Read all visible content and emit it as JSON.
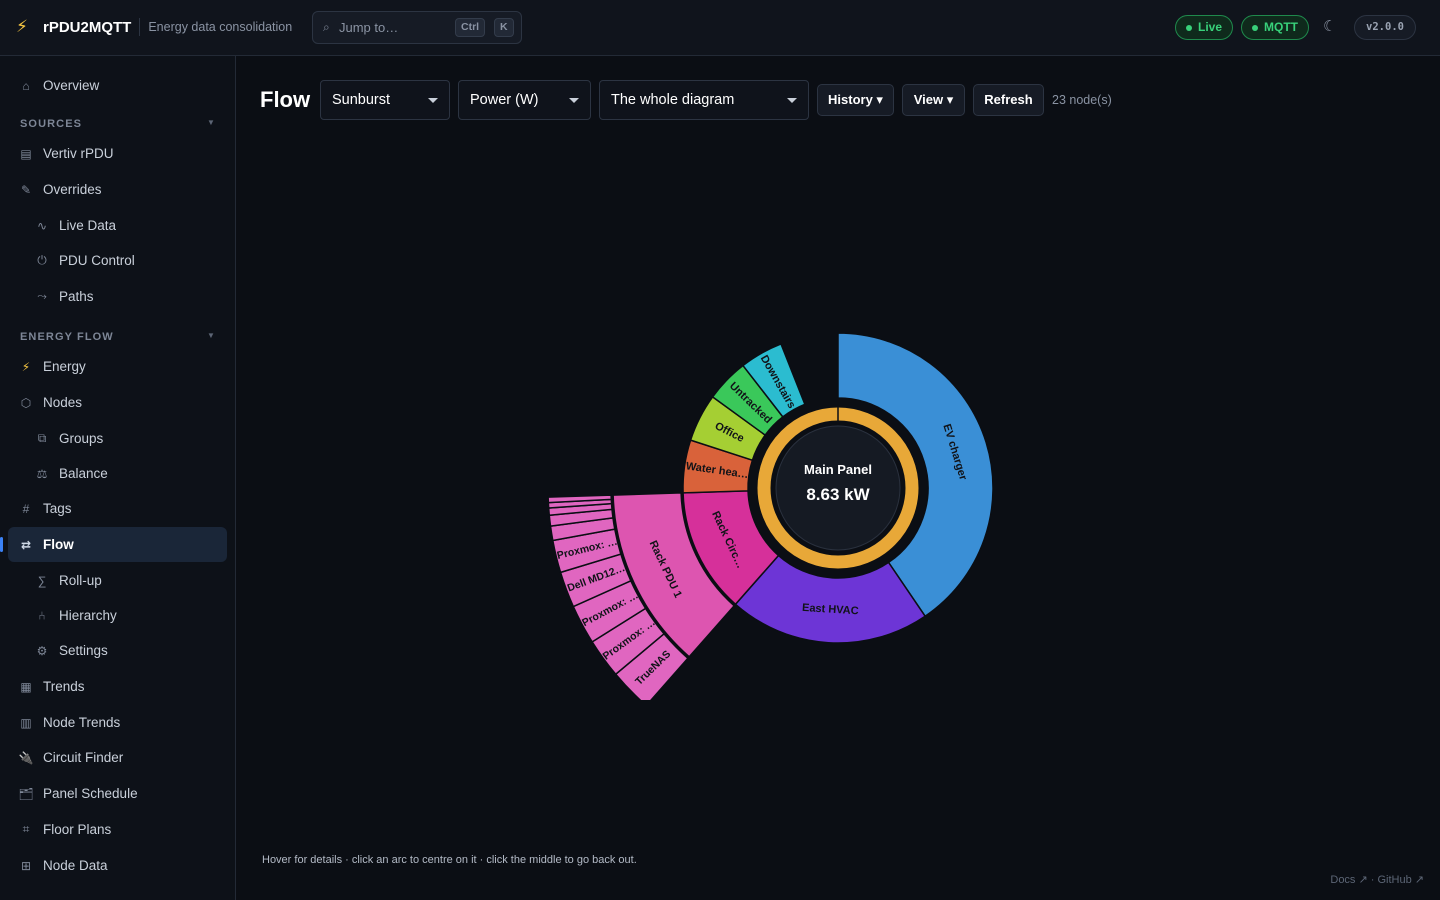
{
  "header": {
    "app_title": "rPDU2MQTT",
    "subtitle": "Energy data consolidation",
    "search_placeholder": "Jump to…",
    "kbd_ctrl": "Ctrl",
    "kbd_k": "K",
    "live_label": "Live",
    "mqtt_label": "MQTT",
    "version": "v2.0.0",
    "icons": {
      "logo": "bolt-icon",
      "search": "search-icon",
      "theme": "moon-icon"
    },
    "status_color": "#38d17a"
  },
  "sidebar": {
    "overview": "Overview",
    "sources_header": "SOURCES",
    "vertiv": "Vertiv rPDU",
    "overrides": "Overrides",
    "live_data": "Live Data",
    "pdu_control": "PDU Control",
    "paths": "Paths",
    "energy_flow_header": "ENERGY FLOW",
    "energy": "Energy",
    "nodes": "Nodes",
    "groups": "Groups",
    "balance": "Balance",
    "tags": "Tags",
    "flow": "Flow",
    "rollup": "Roll-up",
    "hierarchy": "Hierarchy",
    "settings": "Settings",
    "trends": "Trends",
    "node_trends": "Node Trends",
    "circuit_finder": "Circuit Finder",
    "panel_schedule": "Panel Schedule",
    "floor_plans": "Floor Plans",
    "node_data": "Node Data",
    "active_color": "#3b82f6"
  },
  "main": {
    "title": "Flow",
    "chart_type": "Sunburst",
    "metric": "Power (W)",
    "scope": "The whole diagram",
    "history_label": "History ▾",
    "view_label": "View ▾",
    "refresh_label": "Refresh",
    "node_count": "23 node(s)",
    "hint": "Hover for details · click an arc to centre on it · click the middle to go back out.",
    "footer": "Docs ↗ · GitHub ↗"
  },
  "chart_data": {
    "type": "sunburst",
    "center_label": "Main Panel",
    "center_value": "8.63 kW",
    "root": {
      "name": "Main Panel",
      "color": "#e8a838"
    },
    "ring1": [
      {
        "name": "EV charger",
        "label": "EV charger",
        "share": 0.405,
        "color": "#3a8fd6"
      },
      {
        "name": "East HVAC",
        "label": "East HVAC",
        "share": 0.21,
        "color": "#6d35d6"
      },
      {
        "name": "Rack Circuit",
        "label": "Rack Circ…",
        "share": 0.13,
        "color": "#d6309a"
      },
      {
        "name": "Water heater",
        "label": "Water hea…",
        "share": 0.055,
        "color": "#d9623a"
      },
      {
        "name": "Office",
        "label": "Office",
        "share": 0.05,
        "color": "#a5cf33"
      },
      {
        "name": "Untracked",
        "label": "Untracked",
        "share": 0.045,
        "color": "#3ac85a"
      },
      {
        "name": "Downstairs",
        "label": "Downstairs",
        "share": 0.045,
        "color": "#2bbcd0"
      }
    ],
    "ring2": [
      {
        "name": "Rack PDU 1",
        "label": "Rack PDU 1",
        "share": 0.13,
        "parent": "Rack Circuit",
        "color": "#dd55b0"
      }
    ],
    "ring3": [
      {
        "name": "TrueNAS",
        "label": "TrueNAS",
        "share": 0.024
      },
      {
        "name": "Proxmox 1",
        "label": "Proxmox: …",
        "share": 0.022
      },
      {
        "name": "Proxmox 2",
        "label": "Proxmox: …",
        "share": 0.022
      },
      {
        "name": "Dell MD12",
        "label": "Dell MD12…",
        "share": 0.02
      },
      {
        "name": "Proxmox 3",
        "label": "Proxmox: …",
        "share": 0.018
      },
      {
        "name": "Small 1",
        "label": "",
        "share": 0.008
      },
      {
        "name": "Small 2",
        "label": "",
        "share": 0.006
      },
      {
        "name": "Small 3",
        "label": "",
        "share": 0.004
      },
      {
        "name": "Small 4",
        "label": "",
        "share": 0.003
      },
      {
        "name": "Small 5",
        "label": "",
        "share": 0.003
      }
    ],
    "ring3_color": "#e066c0"
  }
}
